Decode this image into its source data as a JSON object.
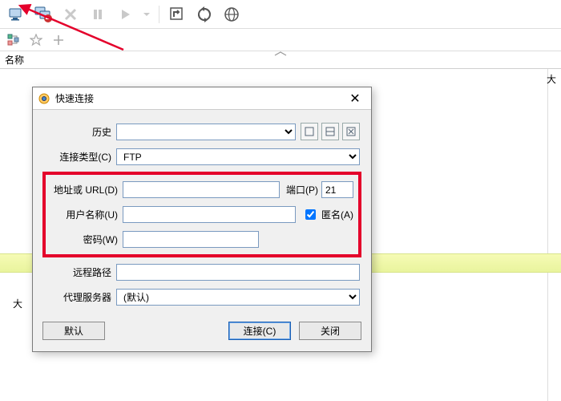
{
  "toolbar": {
    "icons": [
      "computer",
      "computer-x",
      "x",
      "pause",
      "play",
      "dropdown",
      "refresh",
      "sync",
      "globe"
    ]
  },
  "subbar": {
    "icons": [
      "tree",
      "star",
      "plus"
    ]
  },
  "columns": {
    "name": "名称",
    "right": "大"
  },
  "sizeLabel": "大",
  "dialog": {
    "title": "快速连接",
    "history": {
      "label": "历史"
    },
    "connType": {
      "label": "连接类型(C)",
      "value": "FTP"
    },
    "address": {
      "label": "地址或 URL(D)",
      "value": ""
    },
    "port": {
      "label": "端口(P)",
      "value": "21"
    },
    "username": {
      "label": "用户名称(U)",
      "value": ""
    },
    "anonymous": {
      "label": "匿名(A)",
      "checked": true
    },
    "password": {
      "label": "密码(W)",
      "value": ""
    },
    "remotePath": {
      "label": "远程路径",
      "value": ""
    },
    "proxy": {
      "label": "代理服务器",
      "value": "(默认)"
    },
    "buttons": {
      "default": "默认",
      "connect": "连接(C)",
      "close": "关闭"
    }
  }
}
